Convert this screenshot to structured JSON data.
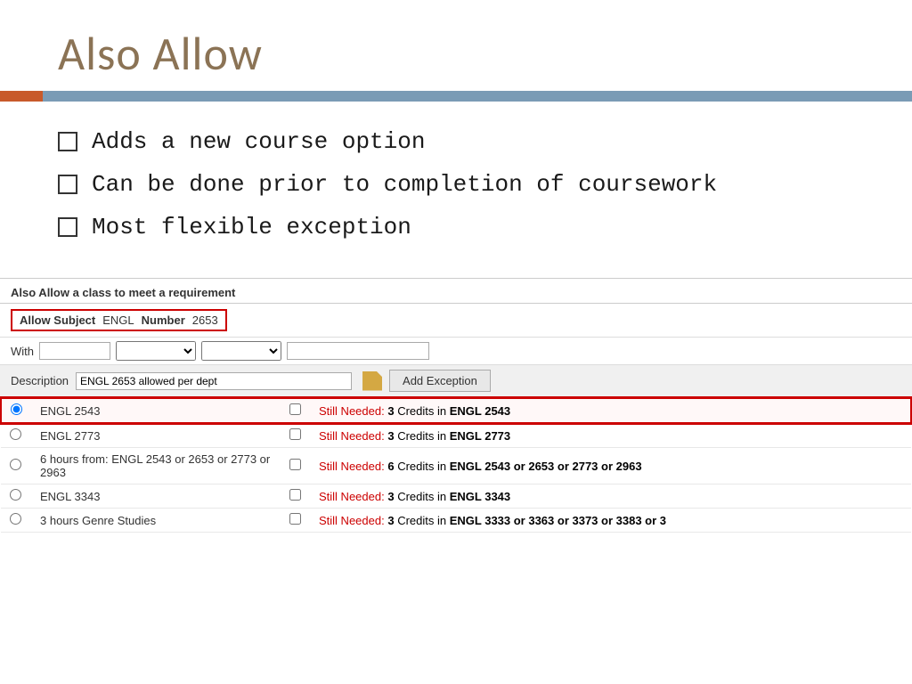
{
  "header": {
    "title": "Also Allow"
  },
  "bullets": [
    {
      "text": "Adds a new course option"
    },
    {
      "text": "Can be done prior to completion of coursework"
    },
    {
      "text": "Most flexible exception"
    }
  ],
  "form": {
    "panel_title": "Also Allow a class to meet a requirement",
    "allow_subject_label": "Allow Subject",
    "allow_subject_value": "ENGL",
    "number_label": "Number",
    "number_value": "2653",
    "with_label": "With",
    "description_label": "Description",
    "description_value": "ENGL 2653 allowed per dept",
    "add_exception_label": "Add Exception"
  },
  "requirements": [
    {
      "selected": true,
      "course": "ENGL 2543",
      "still_needed": "Still Needed:",
      "credits": "3",
      "credits_text": "Credits in",
      "course_bold": "ENGL 2543",
      "highlighted": true
    },
    {
      "selected": false,
      "course": "ENGL 2773",
      "still_needed": "Still Needed:",
      "credits": "3",
      "credits_text": "Credits in",
      "course_bold": "ENGL 2773",
      "highlighted": false
    },
    {
      "selected": false,
      "course": "6 hours from: ENGL 2543 or 2653 or 2773 or 2963",
      "still_needed": "Still Needed:",
      "credits": "6",
      "credits_text": "Credits in",
      "course_bold": "ENGL 2543 or 2653 or 2773 or 2963",
      "highlighted": false
    },
    {
      "selected": false,
      "course": "ENGL 3343",
      "still_needed": "Still Needed:",
      "credits": "3",
      "credits_text": "Credits in",
      "course_bold": "ENGL 3343",
      "highlighted": false
    },
    {
      "selected": false,
      "course": "3 hours Genre Studies",
      "still_needed": "Still Needed:",
      "credits": "3",
      "credits_text": "Credits in",
      "course_bold": "ENGL 3333 or 3363 or 3373 or 3383 or 3",
      "highlighted": false
    }
  ]
}
